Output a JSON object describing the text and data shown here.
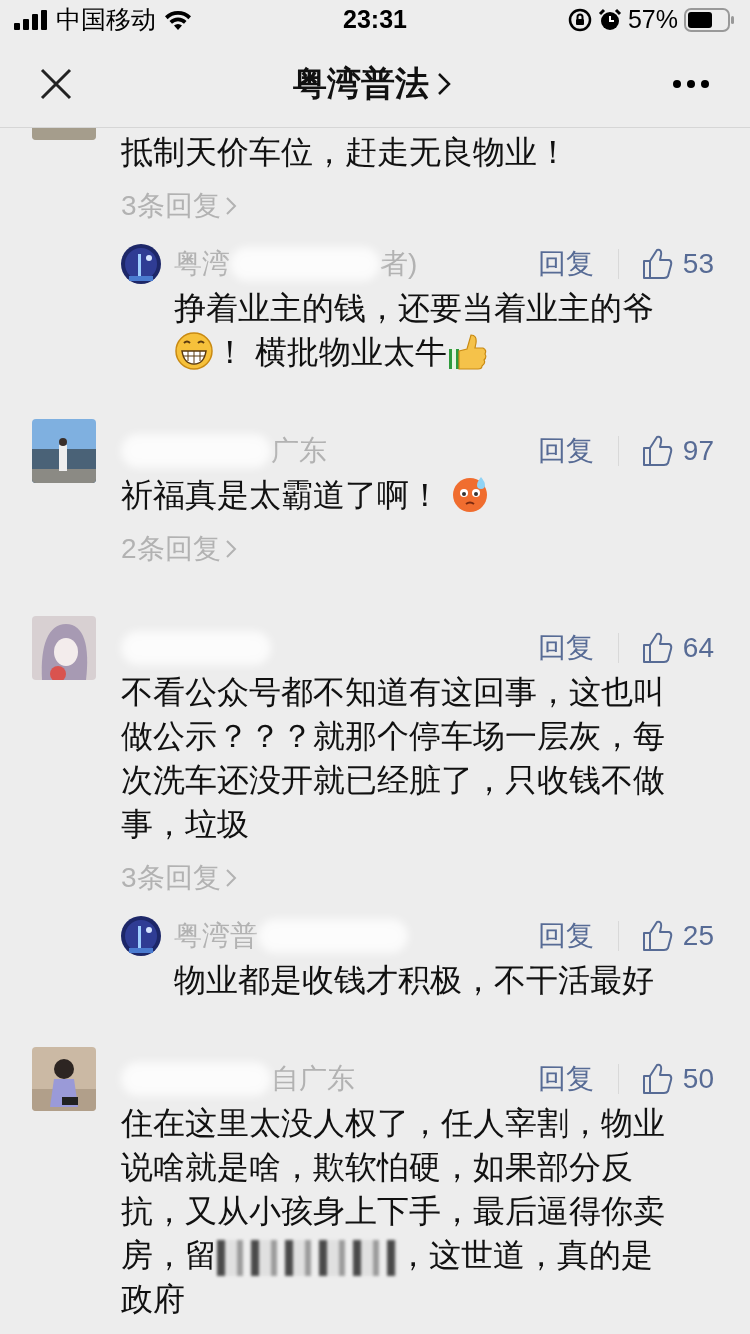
{
  "status_bar": {
    "carrier": "中国移动",
    "time": "23:31",
    "battery": "57%"
  },
  "nav": {
    "title": "粤湾普法"
  },
  "comments": [
    {
      "body": [
        {
          "kind": "text",
          "text": "抵制天价车位，赶走无良物业！"
        }
      ],
      "replies_link": "3条回复",
      "replies": [
        {
          "name_start": "粤湾",
          "name_end": "者)",
          "reply": "回复",
          "likes": "53",
          "body": [
            {
              "kind": "text",
              "text": "挣着业主的钱，还要当着业主的爷"
            },
            {
              "kind": "grin-emoji"
            },
            {
              "kind": "text",
              "text": "！ 横批物业太牛"
            },
            {
              "kind": "thumbs-emoji"
            }
          ]
        }
      ]
    },
    {
      "name_end": "广东",
      "reply": "回复",
      "likes": "97",
      "body": [
        {
          "kind": "text",
          "text": "祈福真是太霸道了啊！ "
        },
        {
          "kind": "sweat-emoji"
        }
      ],
      "replies_link": "2条回复"
    },
    {
      "reply": "回复",
      "likes": "64",
      "body": [
        {
          "kind": "text",
          "text": "不看公众号都不知道有这回事，这也叫做公示？？？就那个停车场一层灰，每次洗车还没开就已经脏了，只收钱不做事，垃圾"
        }
      ],
      "replies_link": "3条回复",
      "replies": [
        {
          "name_start": "粤湾普",
          "reply": "回复",
          "likes": "25",
          "body": [
            {
              "kind": "text",
              "text": "物业都是收钱才积极，不干活最好"
            }
          ]
        }
      ]
    },
    {
      "name_end": "自广东",
      "reply": "回复",
      "likes": "50",
      "body": [
        {
          "kind": "text",
          "text": "住在这里太没人权了，任人宰割，物业说啥就是啥，欺软怕硬，如果部分反抗，又从小孩身上下手，最后逼得你卖房，留"
        },
        {
          "kind": "mosaic"
        },
        {
          "kind": "text",
          "text": "，这世道，真的是政府"
        }
      ]
    }
  ]
}
